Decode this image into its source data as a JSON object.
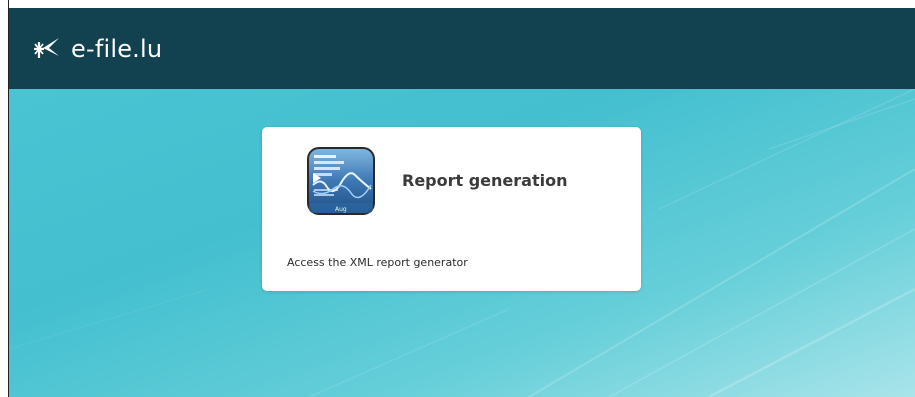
{
  "header": {
    "brand": "e-file.lu",
    "logo_icon": "efile-logo-icon",
    "background_color": "#12414f"
  },
  "main": {
    "card": {
      "title": "Report generation",
      "description": "Access the XML report generator",
      "icon": "report-chart-icon"
    }
  },
  "colors": {
    "hero_gradient_start": "#43bfcf",
    "hero_gradient_end": "#a9e4ea",
    "card_background": "#ffffff"
  }
}
